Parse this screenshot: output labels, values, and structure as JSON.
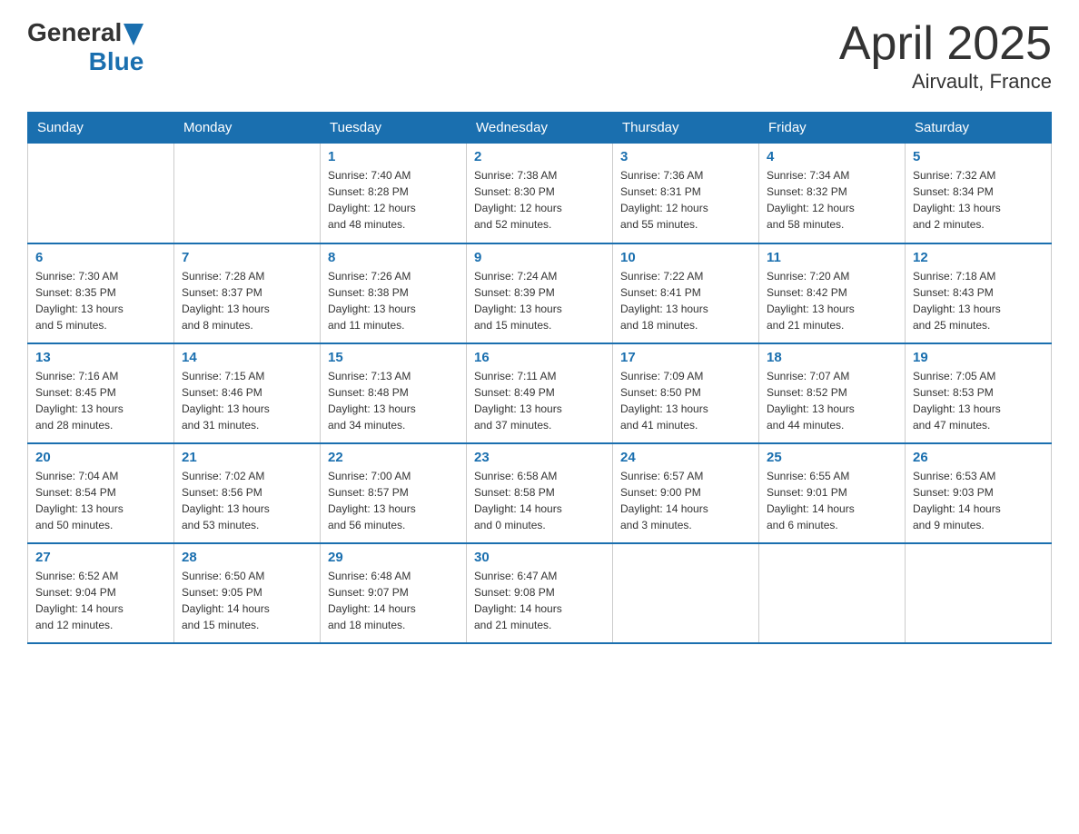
{
  "logo": {
    "general": "General",
    "blue": "Blue"
  },
  "title": "April 2025",
  "subtitle": "Airvault, France",
  "headers": [
    "Sunday",
    "Monday",
    "Tuesday",
    "Wednesday",
    "Thursday",
    "Friday",
    "Saturday"
  ],
  "weeks": [
    [
      {
        "day": "",
        "info": ""
      },
      {
        "day": "",
        "info": ""
      },
      {
        "day": "1",
        "info": "Sunrise: 7:40 AM\nSunset: 8:28 PM\nDaylight: 12 hours\nand 48 minutes."
      },
      {
        "day": "2",
        "info": "Sunrise: 7:38 AM\nSunset: 8:30 PM\nDaylight: 12 hours\nand 52 minutes."
      },
      {
        "day": "3",
        "info": "Sunrise: 7:36 AM\nSunset: 8:31 PM\nDaylight: 12 hours\nand 55 minutes."
      },
      {
        "day": "4",
        "info": "Sunrise: 7:34 AM\nSunset: 8:32 PM\nDaylight: 12 hours\nand 58 minutes."
      },
      {
        "day": "5",
        "info": "Sunrise: 7:32 AM\nSunset: 8:34 PM\nDaylight: 13 hours\nand 2 minutes."
      }
    ],
    [
      {
        "day": "6",
        "info": "Sunrise: 7:30 AM\nSunset: 8:35 PM\nDaylight: 13 hours\nand 5 minutes."
      },
      {
        "day": "7",
        "info": "Sunrise: 7:28 AM\nSunset: 8:37 PM\nDaylight: 13 hours\nand 8 minutes."
      },
      {
        "day": "8",
        "info": "Sunrise: 7:26 AM\nSunset: 8:38 PM\nDaylight: 13 hours\nand 11 minutes."
      },
      {
        "day": "9",
        "info": "Sunrise: 7:24 AM\nSunset: 8:39 PM\nDaylight: 13 hours\nand 15 minutes."
      },
      {
        "day": "10",
        "info": "Sunrise: 7:22 AM\nSunset: 8:41 PM\nDaylight: 13 hours\nand 18 minutes."
      },
      {
        "day": "11",
        "info": "Sunrise: 7:20 AM\nSunset: 8:42 PM\nDaylight: 13 hours\nand 21 minutes."
      },
      {
        "day": "12",
        "info": "Sunrise: 7:18 AM\nSunset: 8:43 PM\nDaylight: 13 hours\nand 25 minutes."
      }
    ],
    [
      {
        "day": "13",
        "info": "Sunrise: 7:16 AM\nSunset: 8:45 PM\nDaylight: 13 hours\nand 28 minutes."
      },
      {
        "day": "14",
        "info": "Sunrise: 7:15 AM\nSunset: 8:46 PM\nDaylight: 13 hours\nand 31 minutes."
      },
      {
        "day": "15",
        "info": "Sunrise: 7:13 AM\nSunset: 8:48 PM\nDaylight: 13 hours\nand 34 minutes."
      },
      {
        "day": "16",
        "info": "Sunrise: 7:11 AM\nSunset: 8:49 PM\nDaylight: 13 hours\nand 37 minutes."
      },
      {
        "day": "17",
        "info": "Sunrise: 7:09 AM\nSunset: 8:50 PM\nDaylight: 13 hours\nand 41 minutes."
      },
      {
        "day": "18",
        "info": "Sunrise: 7:07 AM\nSunset: 8:52 PM\nDaylight: 13 hours\nand 44 minutes."
      },
      {
        "day": "19",
        "info": "Sunrise: 7:05 AM\nSunset: 8:53 PM\nDaylight: 13 hours\nand 47 minutes."
      }
    ],
    [
      {
        "day": "20",
        "info": "Sunrise: 7:04 AM\nSunset: 8:54 PM\nDaylight: 13 hours\nand 50 minutes."
      },
      {
        "day": "21",
        "info": "Sunrise: 7:02 AM\nSunset: 8:56 PM\nDaylight: 13 hours\nand 53 minutes."
      },
      {
        "day": "22",
        "info": "Sunrise: 7:00 AM\nSunset: 8:57 PM\nDaylight: 13 hours\nand 56 minutes."
      },
      {
        "day": "23",
        "info": "Sunrise: 6:58 AM\nSunset: 8:58 PM\nDaylight: 14 hours\nand 0 minutes."
      },
      {
        "day": "24",
        "info": "Sunrise: 6:57 AM\nSunset: 9:00 PM\nDaylight: 14 hours\nand 3 minutes."
      },
      {
        "day": "25",
        "info": "Sunrise: 6:55 AM\nSunset: 9:01 PM\nDaylight: 14 hours\nand 6 minutes."
      },
      {
        "day": "26",
        "info": "Sunrise: 6:53 AM\nSunset: 9:03 PM\nDaylight: 14 hours\nand 9 minutes."
      }
    ],
    [
      {
        "day": "27",
        "info": "Sunrise: 6:52 AM\nSunset: 9:04 PM\nDaylight: 14 hours\nand 12 minutes."
      },
      {
        "day": "28",
        "info": "Sunrise: 6:50 AM\nSunset: 9:05 PM\nDaylight: 14 hours\nand 15 minutes."
      },
      {
        "day": "29",
        "info": "Sunrise: 6:48 AM\nSunset: 9:07 PM\nDaylight: 14 hours\nand 18 minutes."
      },
      {
        "day": "30",
        "info": "Sunrise: 6:47 AM\nSunset: 9:08 PM\nDaylight: 14 hours\nand 21 minutes."
      },
      {
        "day": "",
        "info": ""
      },
      {
        "day": "",
        "info": ""
      },
      {
        "day": "",
        "info": ""
      }
    ]
  ]
}
